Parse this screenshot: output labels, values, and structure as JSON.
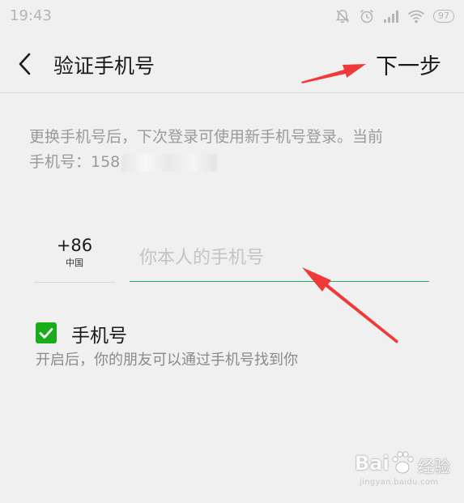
{
  "status_bar": {
    "time": "19:43",
    "battery": "97",
    "icons": [
      "mute-bell-icon",
      "alarm-icon",
      "signal-icon",
      "wifi-icon",
      "battery-icon"
    ]
  },
  "toolbar": {
    "title": "验证手机号",
    "next_label": "下一步",
    "back_icon": "chevron-left-icon"
  },
  "description": {
    "line1": "更换手机号后，下次登录可使用新手机号登录。当前",
    "line2_prefix": "手机号：158"
  },
  "phone_form": {
    "country_code": "+86",
    "country_name": "中国",
    "phone_value": "",
    "phone_placeholder": "你本人的手机号"
  },
  "discover_option": {
    "checked": true,
    "label": "手机号",
    "hint": "开启后，你的朋友可以通过手机号找到你"
  },
  "colors": {
    "accent_green": "#1aad19",
    "input_underline": "#1aad6e",
    "annotation_red": "#f03a3a",
    "background": "#f0f0f0"
  },
  "watermark": {
    "brand": "Bai",
    "cn": "经验",
    "url": "jingyan.baidu.com"
  }
}
